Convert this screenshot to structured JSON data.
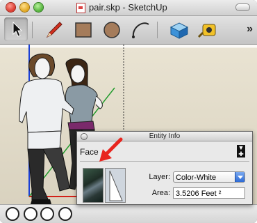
{
  "window": {
    "title": "pair.skp - SketchUp"
  },
  "toolbar": {
    "tools": [
      {
        "name": "Select"
      },
      {
        "name": "Line"
      },
      {
        "name": "Rectangle"
      },
      {
        "name": "Circle"
      },
      {
        "name": "Arc"
      },
      {
        "name": "Make Component"
      },
      {
        "name": "Tape Measure"
      }
    ],
    "overflow_label": "»"
  },
  "entity_info": {
    "title": "Entity Info",
    "type_label": "Face",
    "layer_label": "Layer:",
    "layer_value": "Color-White",
    "area_label": "Area:",
    "area_value": "3.5206 Feet ²"
  },
  "colors": {
    "axis_red": "#d22018",
    "axis_green": "#1f9a2a",
    "axis_blue": "#1a3fd6",
    "annotation_arrow": "#e8251e",
    "select_accent": "#2d6bd6"
  }
}
